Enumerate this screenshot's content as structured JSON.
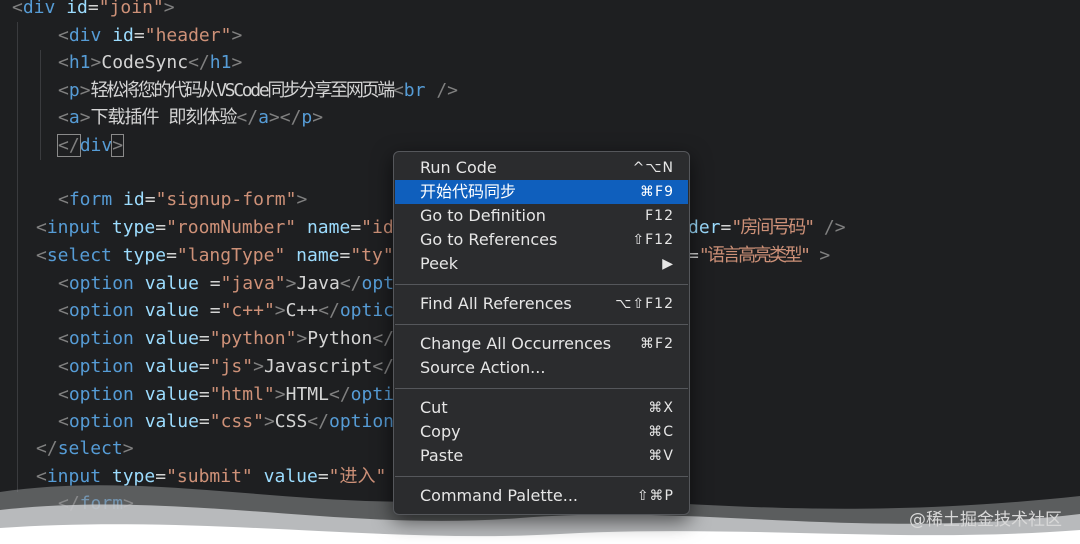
{
  "code": {
    "l1": {
      "open": "<",
      "tag": "div",
      "attr": "id",
      "eq": "=",
      "val": "\"join\"",
      "close": ">"
    },
    "l2": {
      "open": "<",
      "tag": "div",
      "attr": "id",
      "eq": "=",
      "val": "\"header\"",
      "close": ">"
    },
    "l3": {
      "open": "<",
      "tag": "h1",
      "close": ">",
      "text": "CodeSync",
      "endopen": "</",
      "endtag": "h1",
      "endclose": ">"
    },
    "l4": {
      "open": "<",
      "tag": "p",
      "close": ">",
      "text": "轻松将您的代码从VSCode同步分享至网页端",
      "bropen": "<",
      "brtag": "br",
      "brclose": " />"
    },
    "l5": {
      "open": "<",
      "tag": "a",
      "close": ">",
      "text": "下载插件 即刻体验",
      "endopen": "</",
      "endtag": "a",
      "endmid": "></",
      "endtag2": "p",
      "endclose": ">"
    },
    "l6": {
      "open": "</",
      "tag": "div",
      "close": ">"
    },
    "l7": {
      "open": "<",
      "tag": "form",
      "attr": "id",
      "eq": "=",
      "val": "\"signup-form\"",
      "close": ">"
    },
    "l8": {
      "open": "<",
      "tag": "input",
      "attr1": "type",
      "eq1": "=",
      "val1": "\"roomNumber\"",
      "attr2": "name",
      "eq2": "=",
      "val2": "\"id",
      "tailattr": "der",
      "taileq": "=",
      "tailval": "\"房间号码\"",
      "tailclose": " />"
    },
    "l9": {
      "open": "<",
      "tag": "select",
      "attr1": "type",
      "eq1": "=",
      "val1": "\"langType\"",
      "attr2": "name",
      "eq2": "=",
      "val2": "\"ty\"",
      "taileq": "=",
      "tailval": "\"语言高亮类型\"",
      "tailclose": " >"
    },
    "l10": {
      "open": "<",
      "tag": "option",
      "attr": "value",
      "eq": " =",
      "val": "\"java\"",
      "close": ">",
      "text": "Java",
      "endopen": "</",
      "endtag": "opt"
    },
    "l11": {
      "open": "<",
      "tag": "option",
      "attr": "value",
      "eq": " =",
      "val": "\"c++\"",
      "close": ">",
      "text": "C++",
      "endopen": "</",
      "endtag": "optic"
    },
    "l12": {
      "open": "<",
      "tag": "option",
      "attr": "value",
      "eq": "=",
      "val": "\"python\"",
      "close": ">",
      "text": "Python",
      "endopen": "</"
    },
    "l13": {
      "open": "<",
      "tag": "option",
      "attr": "value",
      "eq": "=",
      "val": "\"js\"",
      "close": ">",
      "text": "Javascript",
      "endopen": "</"
    },
    "l14": {
      "open": "<",
      "tag": "option",
      "attr": "value",
      "eq": "=",
      "val": "\"html\"",
      "close": ">",
      "text": "HTML",
      "endopen": "</",
      "endtag": "opti"
    },
    "l15": {
      "open": "<",
      "tag": "option",
      "attr": "value",
      "eq": "=",
      "val": "\"css\"",
      "close": ">",
      "text": "CSS",
      "endopen": "</",
      "endtag": "option"
    },
    "l16": {
      "open": "</",
      "tag": "select",
      "close": ">"
    },
    "l17": {
      "open": "<",
      "tag": "input",
      "attr1": "type",
      "eq1": "=",
      "val1": "\"submit\"",
      "attr2": "value",
      "eq2": "=",
      "val2": "\"进入\""
    },
    "l18": {
      "open": "</",
      "tag": "form",
      "close": ">"
    }
  },
  "menu": {
    "items": [
      {
        "label": "Run Code",
        "key": "^⌥N"
      },
      {
        "label": "开始代码同步",
        "key": "⌘F9"
      },
      {
        "label": "Go to Definition",
        "key": "F12"
      },
      {
        "label": "Go to References",
        "key": "⇧F12"
      },
      {
        "label": "Peek",
        "key": "▶"
      },
      {
        "label": "Find All References",
        "key": "⌥⇧F12"
      },
      {
        "label": "Change All Occurrences",
        "key": "⌘F2"
      },
      {
        "label": "Source Action...",
        "key": ""
      },
      {
        "label": "Cut",
        "key": "⌘X"
      },
      {
        "label": "Copy",
        "key": "⌘C"
      },
      {
        "label": "Paste",
        "key": "⌘V"
      },
      {
        "label": "Command Palette...",
        "key": "⇧⌘P"
      }
    ],
    "selected_index": 1
  },
  "watermark": "@稀土掘金技术社区",
  "colors": {
    "tag": "#569cd6",
    "attr": "#9cdcfe",
    "string": "#ce9178",
    "selection": "#0f5fbd",
    "background": "#1e1f21"
  }
}
